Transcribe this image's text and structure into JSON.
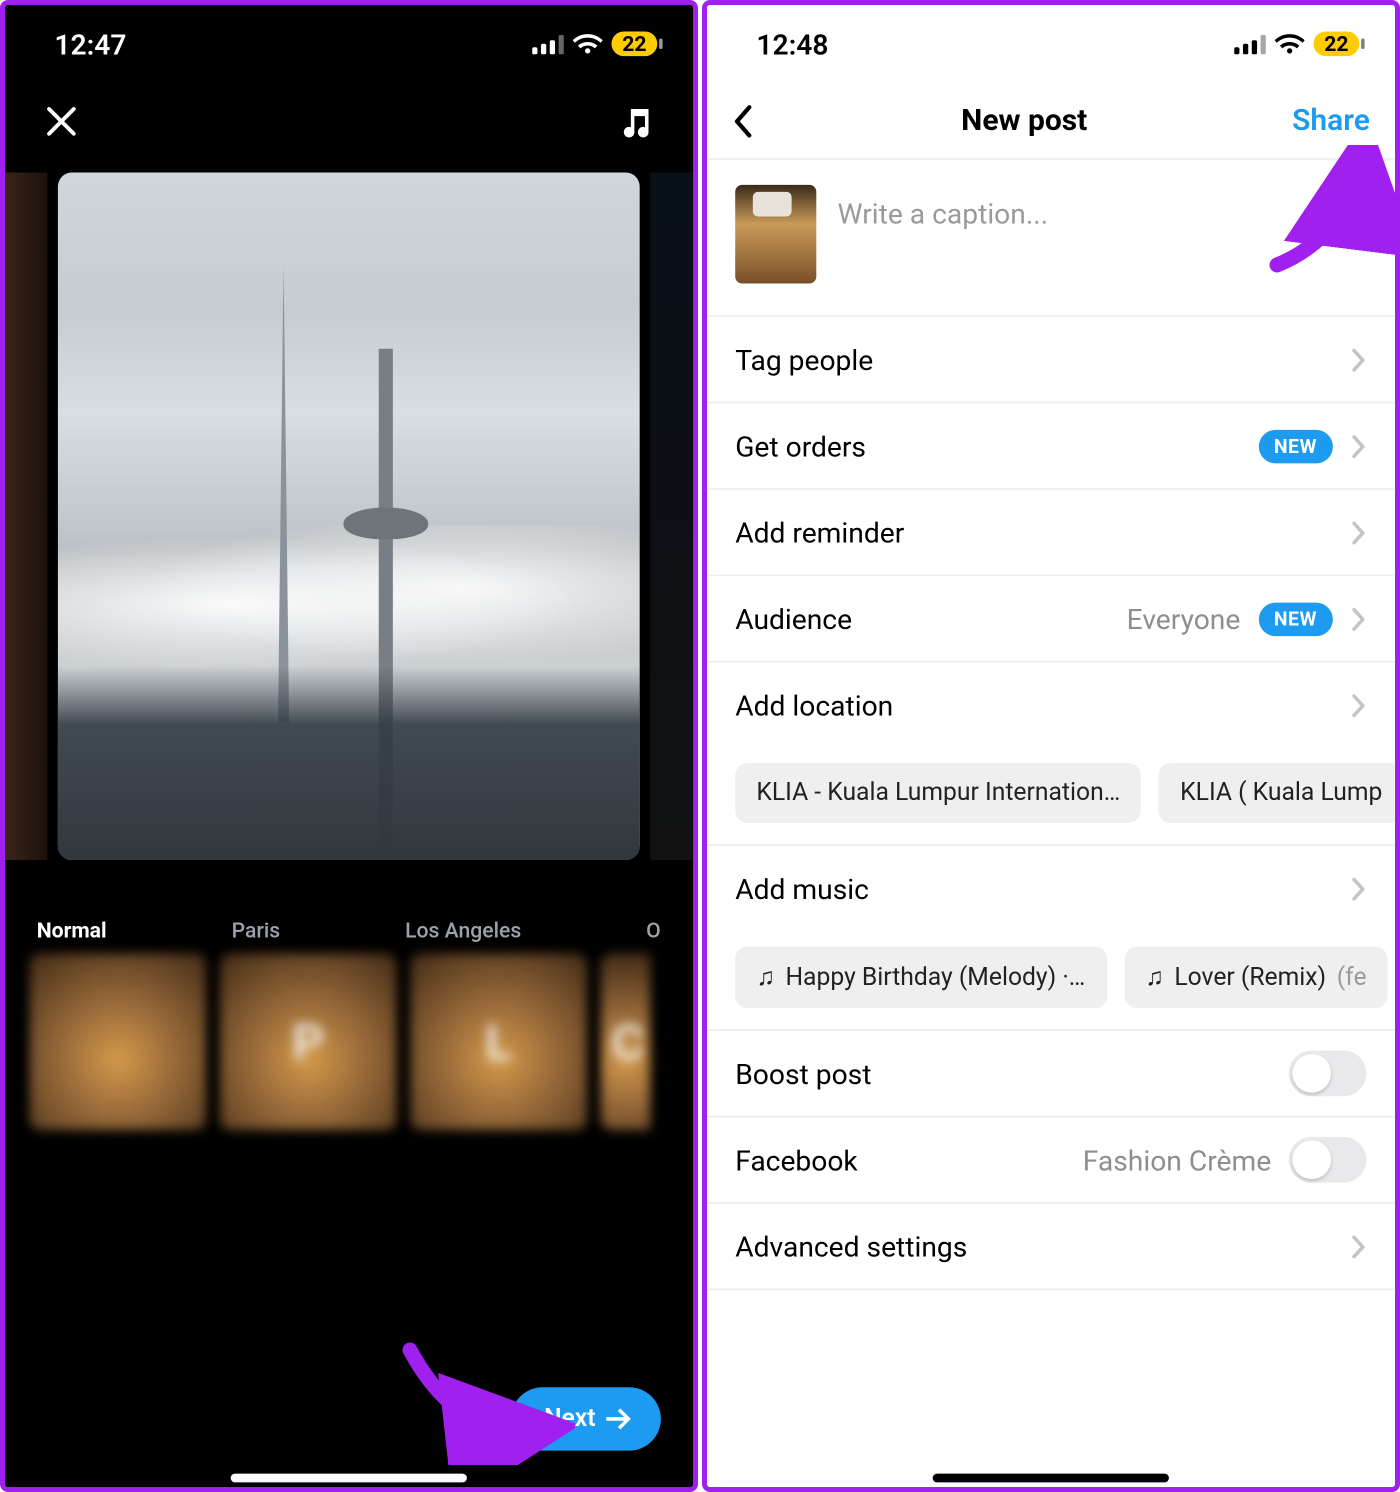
{
  "panelA": {
    "status": {
      "time": "12:47",
      "battery": "22"
    },
    "filters": {
      "items": [
        "Normal",
        "Paris",
        "Los Angeles",
        "O"
      ],
      "letters": [
        "",
        "P",
        "L",
        "C"
      ]
    },
    "next_label": "Next"
  },
  "panelB": {
    "status": {
      "time": "12:48",
      "battery": "22"
    },
    "nav": {
      "title": "New post",
      "share": "Share"
    },
    "caption_placeholder": "Write a caption...",
    "rows": {
      "tag_people": "Tag people",
      "get_orders": "Get orders",
      "badge_new": "NEW",
      "add_reminder": "Add reminder",
      "audience_label": "Audience",
      "audience_value": "Everyone",
      "add_location": "Add location",
      "add_music": "Add music",
      "boost": "Boost post",
      "facebook_label": "Facebook",
      "facebook_value": "Fashion Crème",
      "advanced": "Advanced settings"
    },
    "location_chips": [
      "KLIA - Kuala Lumpur Internation…",
      "KLIA ( Kuala Lump"
    ],
    "music_chips": [
      {
        "title": "Happy Birthday (Melody) ·…"
      },
      {
        "title": "Lover (Remix)",
        "meta": "(fe"
      }
    ]
  }
}
